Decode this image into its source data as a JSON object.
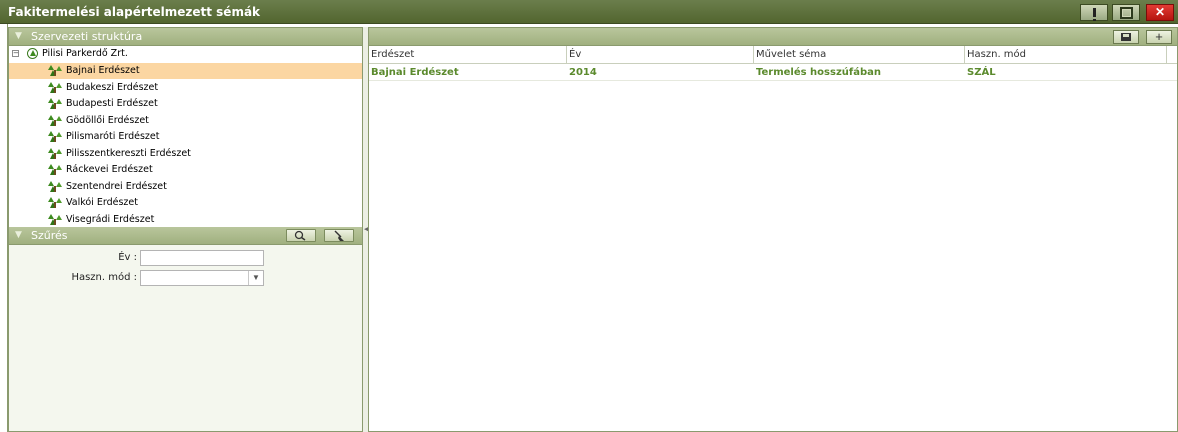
{
  "window": {
    "title": "Fakitermelési alapértelmezett sémák",
    "buttons": [
      "help",
      "maximize",
      "close"
    ]
  },
  "org_structure": {
    "header": "Szervezeti struktúra",
    "root": {
      "label": "Pilisi Parkerdő Zrt.",
      "expanded": true,
      "icon": "tree-up-icon"
    },
    "items": [
      {
        "label": "Bajnai Erdészet",
        "selected": true
      },
      {
        "label": "Budakeszi Erdészet"
      },
      {
        "label": "Budapesti Erdészet"
      },
      {
        "label": "Gödöllői Erdészet"
      },
      {
        "label": "Pilismaróti Erdészet"
      },
      {
        "label": "Pilisszentkereszti Erdészet"
      },
      {
        "label": "Ráckevei Erdészet"
      },
      {
        "label": "Szentendrei Erdészet"
      },
      {
        "label": "Valkói Erdészet"
      },
      {
        "label": "Visegrádi Erdészet"
      }
    ]
  },
  "filter": {
    "header": "Szűrés",
    "year_label": "Év :",
    "year_value": "",
    "mode_label": "Haszn. mód :",
    "mode_value": "",
    "buttons": [
      "search-icon",
      "broom-icon"
    ]
  },
  "grid": {
    "toolbar_buttons": [
      "save-icon",
      "add-icon"
    ],
    "columns": [
      "Erdészet",
      "Év",
      "Művelet séma",
      "Haszn. mód"
    ],
    "rows": [
      [
        "Bajnai Erdészet",
        "2014",
        "Termelés hosszúfában",
        "SZÁL"
      ]
    ]
  },
  "colors": {
    "title_bar": "#5d7039",
    "section_header": "#aebc8e",
    "selection": "#fbd6a2",
    "row_text": "#5b8a2d",
    "close_button": "#d22a22"
  }
}
